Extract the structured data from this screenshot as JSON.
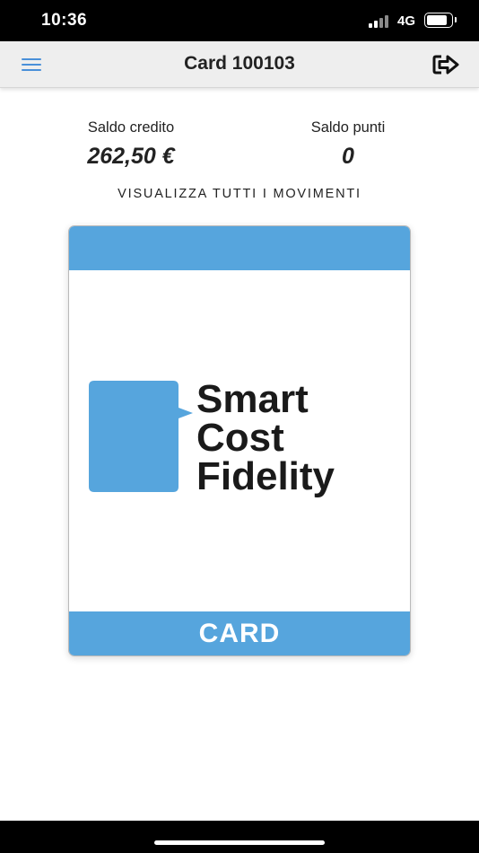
{
  "status_bar": {
    "time": "10:36",
    "network": "4G",
    "signal_icon": "signal-bars-icon",
    "battery_icon": "battery-icon"
  },
  "header": {
    "title": "Card 100103",
    "menu_icon": "hamburger-menu-icon",
    "logout_icon": "logout-arrow-icon",
    "menu_color": "#4a90d9",
    "background": "#eeeeee"
  },
  "balances": {
    "credit_label": "Saldo credito",
    "credit_value": "262,50 €",
    "points_label": "Saldo punti",
    "points_value": "0"
  },
  "movements_link": "VISUALIZZA TUTTI I MOVIMENTI",
  "card": {
    "logo_lines": [
      "Smart",
      "Cost",
      "Fidelity"
    ],
    "bottom_label": "CARD",
    "accent_color": "#56a5dd"
  }
}
